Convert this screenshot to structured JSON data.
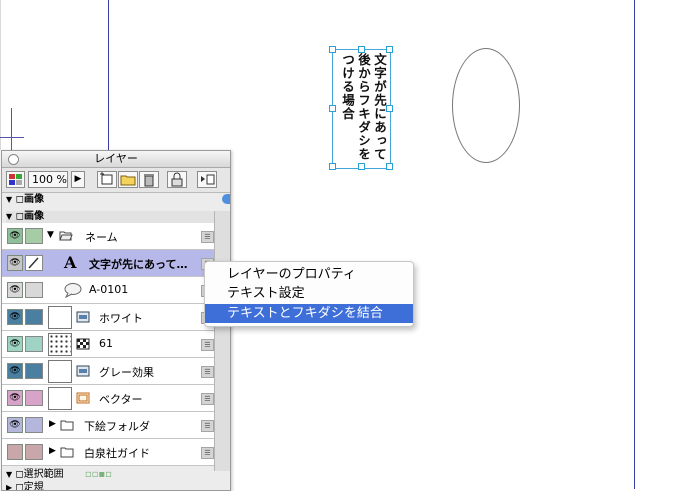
{
  "canvas": {
    "vertical_text": [
      "文字が先にあって",
      "後からフキダシを",
      "つける場合"
    ]
  },
  "palette": {
    "title": "レイヤー",
    "zoom": "100 %",
    "section_label": "画像",
    "layers": [
      {
        "name": "ネーム",
        "kind": "folder",
        "eye_color": "#8fbf9a",
        "swatch": "#a6cca6",
        "expanded": true
      },
      {
        "name": "文字が先にあって…",
        "kind": "text",
        "eye_color": "#b7b8ea",
        "swatch": "#b7b8ea",
        "selected": true
      },
      {
        "name": "A-0101",
        "kind": "balloon",
        "eye_color": "#d8d8d8",
        "swatch": "#d8d8d8"
      },
      {
        "name": "ホワイト",
        "kind": "raster",
        "eye_color": "#4a7fa1",
        "swatch": "#4a7fa1"
      },
      {
        "name": "61",
        "kind": "tone",
        "eye_color": "#9fd3c3",
        "swatch": "#9fd3c3"
      },
      {
        "name": "グレー効果",
        "kind": "raster",
        "eye_color": "#4a7fa1",
        "swatch": "#4a7fa1"
      },
      {
        "name": "ベクター",
        "kind": "vector",
        "eye_color": "#d7a3c9",
        "swatch": "#d7a3c9"
      },
      {
        "name": "下絵フォルダ",
        "kind": "folder",
        "eye_color": "#b4b6dc",
        "swatch": "#b4b6dc"
      },
      {
        "name": "白泉社ガイド",
        "kind": "folder",
        "eye_color": "#c8a6aa",
        "swatch": "#c8a6aa"
      }
    ],
    "selection_section": "選択範囲",
    "bottom_section": "定規"
  },
  "context_menu": {
    "items": [
      {
        "label": "レイヤーのプロパティ",
        "active": false
      },
      {
        "label": "テキスト設定",
        "active": false
      },
      {
        "label": "テキストとフキダシを結合",
        "active": true
      }
    ]
  }
}
